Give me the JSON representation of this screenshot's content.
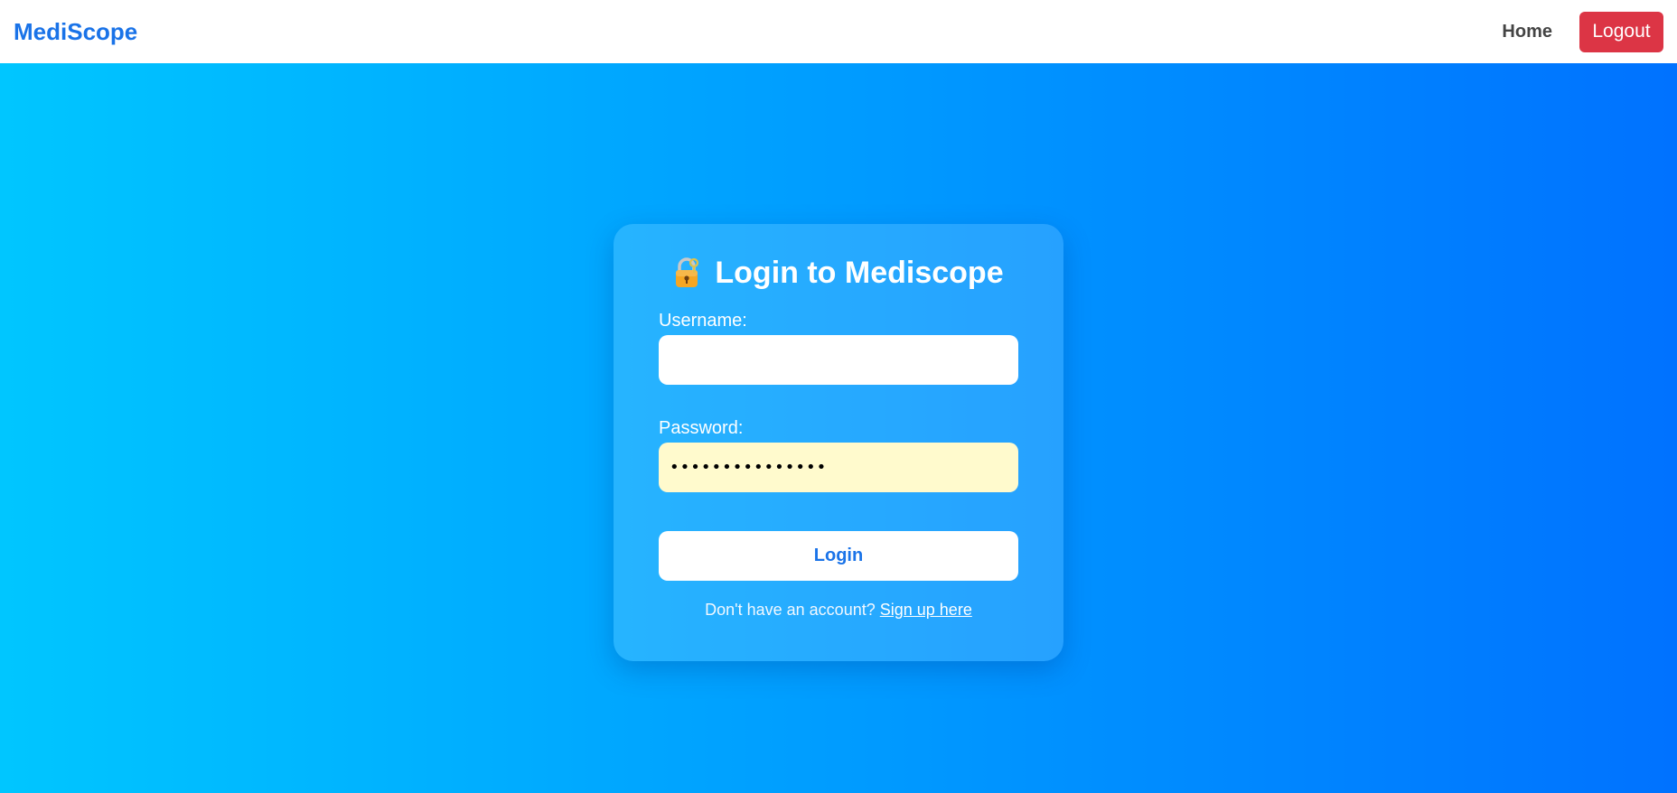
{
  "navbar": {
    "brand": "MediScope",
    "home_label": "Home",
    "logout_label": "Logout"
  },
  "login_card": {
    "title": "Login to Mediscope",
    "title_icon": "lock-with-key-icon",
    "username_label": "Username:",
    "username_value": "",
    "password_label": "Password:",
    "password_value": "•••••••••••••••",
    "login_button": "Login",
    "signup_prompt": "Don't have an account?",
    "signup_link": "Sign up here"
  },
  "colors": {
    "brand": "#1a73e8",
    "logout_button": "#dc3545",
    "gradient_start": "#00c6ff",
    "gradient_end": "#0072ff",
    "autofill_background": "#fffacd"
  }
}
